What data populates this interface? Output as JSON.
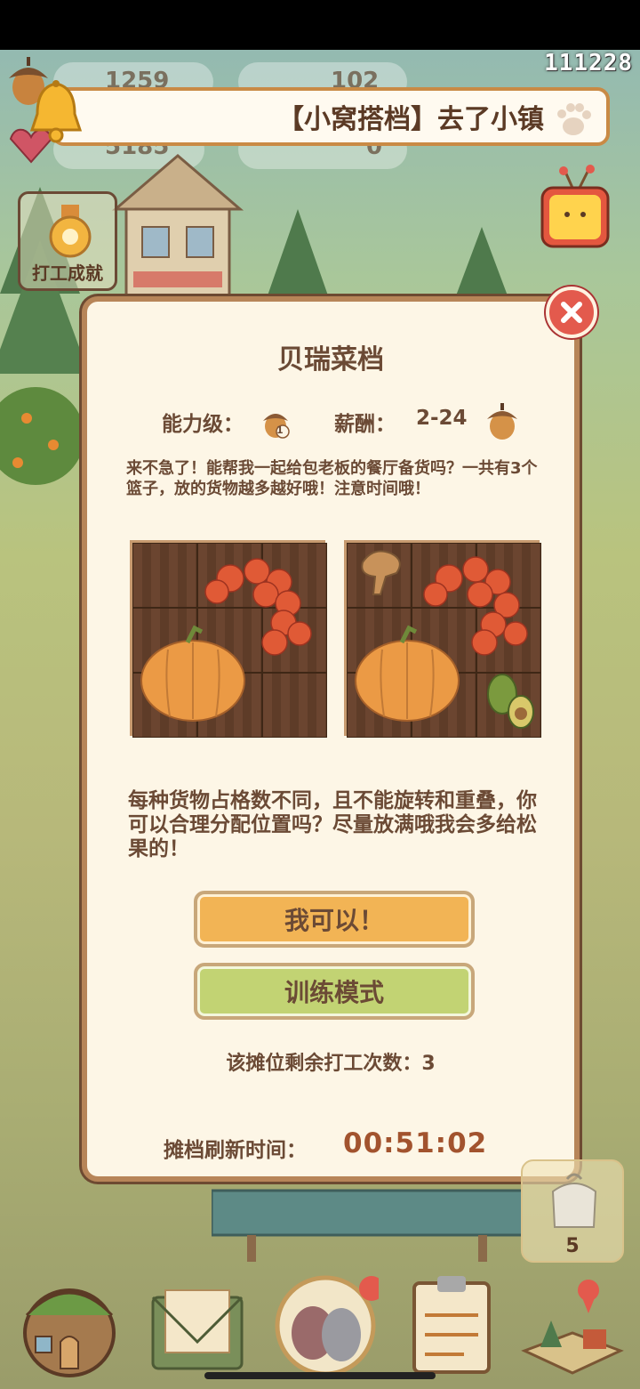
{
  "top": {
    "uid": "111228",
    "resources": [
      "1259",
      "102",
      "5185",
      "0"
    ],
    "notice": "【小窝搭档】去了小镇"
  },
  "achievement": {
    "label": "打工成就"
  },
  "modal": {
    "title": "贝瑞菜档",
    "ability_label": "能力级：",
    "ability_level": "1",
    "salary_label": "薪酬：",
    "salary_value": "2-24",
    "description": "来不急了！能帮我一起给包老板的餐厅备货吗？一共有3个篮子，放的货物越多越好哦！注意时间哦！",
    "description2": "每种货物占格数不同，且不能旋转和重叠，你可以合理分配位置吗？尽量放满哦我会多给松果的！",
    "btn_yes": "我可以！",
    "btn_train": "训练模式",
    "remaining": "该摊位剩余打工次数：3",
    "refresh_label": "摊档刷新时间：",
    "refresh_time": "00:51:02"
  },
  "box": {
    "count": "5"
  },
  "nav": {
    "items": [
      "home-icon",
      "mail-icon",
      "friends-icon",
      "tasks-icon",
      "map-icon"
    ]
  },
  "colors": {
    "accent": "#f2b455",
    "train": "#c2d373",
    "brown": "#6b4a35",
    "time": "#a2532e"
  }
}
